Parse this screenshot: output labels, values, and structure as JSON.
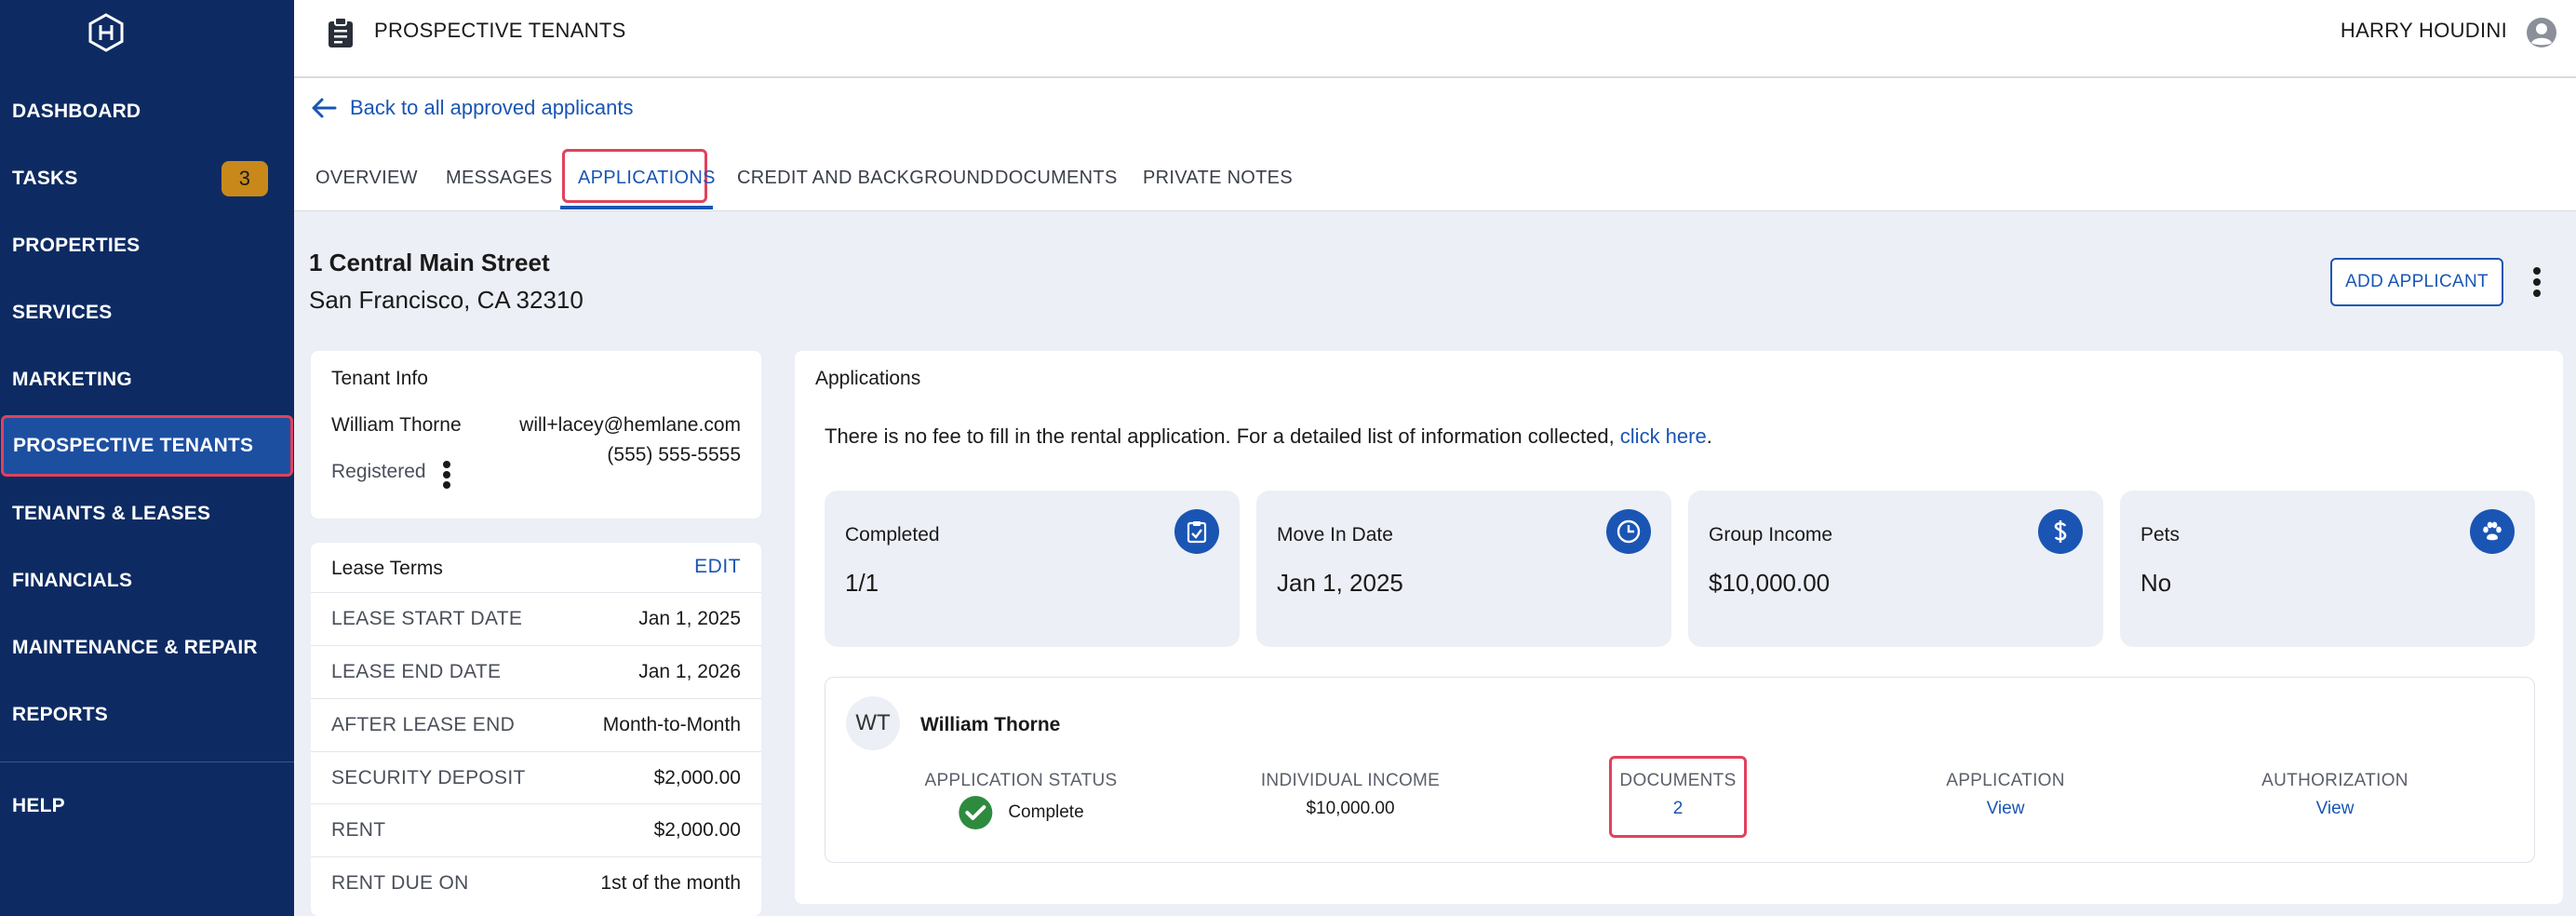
{
  "sidebar": {
    "items": [
      {
        "label": "DASHBOARD"
      },
      {
        "label": "TASKS",
        "badge": "3"
      },
      {
        "label": "PROPERTIES"
      },
      {
        "label": "SERVICES"
      },
      {
        "label": "MARKETING"
      },
      {
        "label": "PROSPECTIVE TENANTS",
        "active": true
      },
      {
        "label": "TENANTS & LEASES"
      },
      {
        "label": "FINANCIALS"
      },
      {
        "label": "MAINTENANCE & REPAIR"
      },
      {
        "label": "REPORTS"
      },
      {
        "label": "HELP"
      }
    ]
  },
  "header": {
    "title": "PROSPECTIVE TENANTS",
    "user": "HARRY HOUDINI"
  },
  "back_link": "Back to all approved applicants",
  "tabs": [
    {
      "label": "OVERVIEW"
    },
    {
      "label": "MESSAGES"
    },
    {
      "label": "APPLICATIONS",
      "active": true
    },
    {
      "label": "CREDIT AND BACKGROUND"
    },
    {
      "label": "DOCUMENTS"
    },
    {
      "label": "PRIVATE NOTES"
    }
  ],
  "property": {
    "line1": "1 Central Main Street",
    "line2": "San Francisco, CA 32310"
  },
  "add_applicant_label": "ADD APPLICANT",
  "tenant_info": {
    "title": "Tenant Info",
    "name": "William Thorne",
    "email": "will+lacey@hemlane.com",
    "phone": "(555) 555-5555",
    "status": "Registered"
  },
  "lease_terms": {
    "title": "Lease Terms",
    "edit_label": "EDIT",
    "rows": [
      {
        "label": "LEASE START DATE",
        "value": "Jan 1, 2025"
      },
      {
        "label": "LEASE END DATE",
        "value": "Jan 1, 2026"
      },
      {
        "label": "AFTER LEASE END",
        "value": "Month-to-Month"
      },
      {
        "label": "SECURITY DEPOSIT",
        "value": "$2,000.00"
      },
      {
        "label": "RENT",
        "value": "$2,000.00"
      },
      {
        "label": "RENT DUE ON",
        "value": "1st of the month"
      }
    ]
  },
  "applications": {
    "title": "Applications",
    "note_text": "There is no fee to fill in the rental application. For a detailed list of information collected, ",
    "note_link": "click here",
    "note_end": ".",
    "stats": [
      {
        "label": "Completed",
        "value": "1/1",
        "icon": "clipboard-check-icon"
      },
      {
        "label": "Move In Date",
        "value": "Jan 1, 2025",
        "icon": "clock-icon"
      },
      {
        "label": "Group Income",
        "value": "$10,000.00",
        "icon": "dollar-icon"
      },
      {
        "label": "Pets",
        "value": "No",
        "icon": "paw-icon"
      }
    ],
    "applicant": {
      "initials": "WT",
      "name": "William Thorne",
      "status_label": "APPLICATION STATUS",
      "status_value": "Complete",
      "income_label": "INDIVIDUAL INCOME",
      "income_value": "$10,000.00",
      "documents_label": "DOCUMENTS",
      "documents_value": "2",
      "application_label": "APPLICATION",
      "application_value": "View",
      "authorization_label": "AUTHORIZATION",
      "authorization_value": "View"
    }
  },
  "colors": {
    "sidebar_bg": "#0d2b62",
    "sidebar_active": "#1d4fa0",
    "accent": "#1a55b4",
    "highlight": "#e0425c",
    "badge": "#c8891a",
    "success": "#2e8b3e"
  }
}
